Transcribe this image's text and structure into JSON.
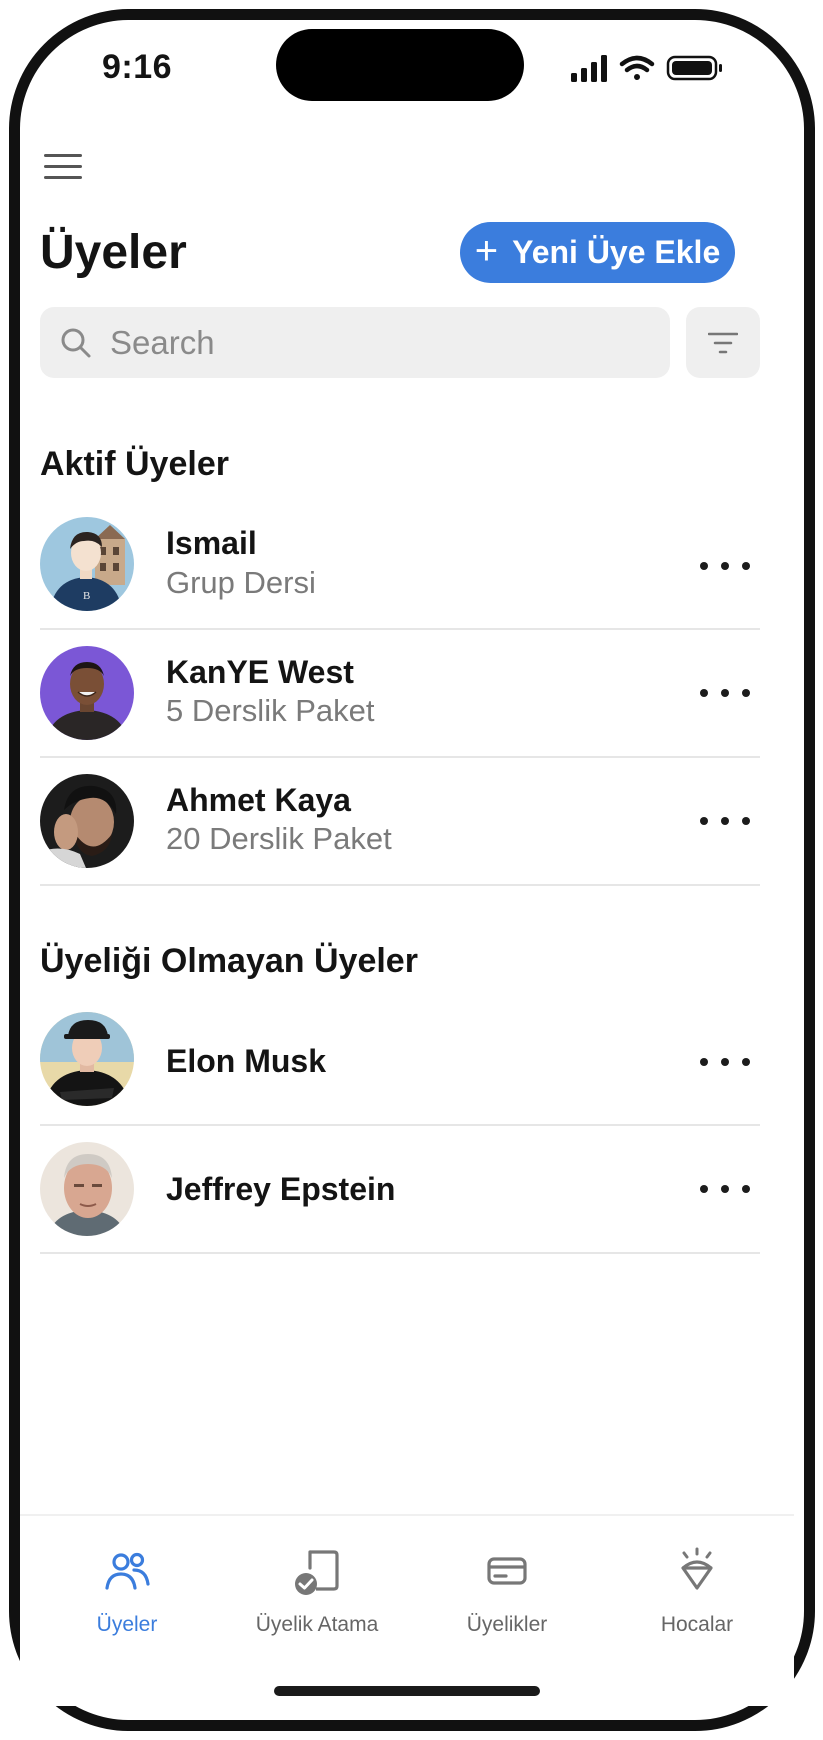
{
  "status_bar": {
    "time": "9:16"
  },
  "header": {
    "title": "Üyeler",
    "add_button_label": "Yeni Üye Ekle"
  },
  "search": {
    "placeholder": "Search"
  },
  "active_section": {
    "title": "Aktif Üyeler",
    "members": [
      {
        "name": "Ismail",
        "plan": "Grup Dersi"
      },
      {
        "name": "KanYE West",
        "plan": "5 Derslik Paket"
      },
      {
        "name": "Ahmet Kaya",
        "plan": "20 Derslik Paket"
      }
    ]
  },
  "inactive_section": {
    "title": "Üyeliği Olmayan Üyeler",
    "members": [
      {
        "name": "Elon Musk"
      },
      {
        "name": "Jeffrey Epstein"
      }
    ]
  },
  "tabbar": {
    "tabs": [
      {
        "label": "Üyeler",
        "icon": "users-icon",
        "active": true
      },
      {
        "label": "Üyelik Atama",
        "icon": "assign-membership-icon",
        "active": false
      },
      {
        "label": "Üyelikler",
        "icon": "card-icon",
        "active": false
      },
      {
        "label": "Hocalar",
        "icon": "diamond-icon",
        "active": false
      }
    ]
  },
  "colors": {
    "accent": "#3b7ddd",
    "text": "#141414",
    "muted": "#7a7a7a",
    "surface": "#efefef"
  }
}
